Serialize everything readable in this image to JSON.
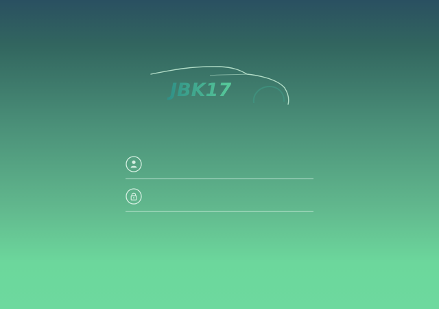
{
  "logo": {
    "text": "JBK17",
    "colors": {
      "outline": "#bfe8d2",
      "text_start": "#2f8f86",
      "text_end": "#53c397"
    }
  },
  "login_form": {
    "username": {
      "icon": "user-icon",
      "value": "",
      "placeholder": ""
    },
    "password": {
      "icon": "lock-icon",
      "value": "",
      "placeholder": ""
    }
  },
  "theme": {
    "gradient_top": "#2a5061",
    "gradient_bottom": "#6dd99e",
    "line_color": "#e1f5eb"
  }
}
